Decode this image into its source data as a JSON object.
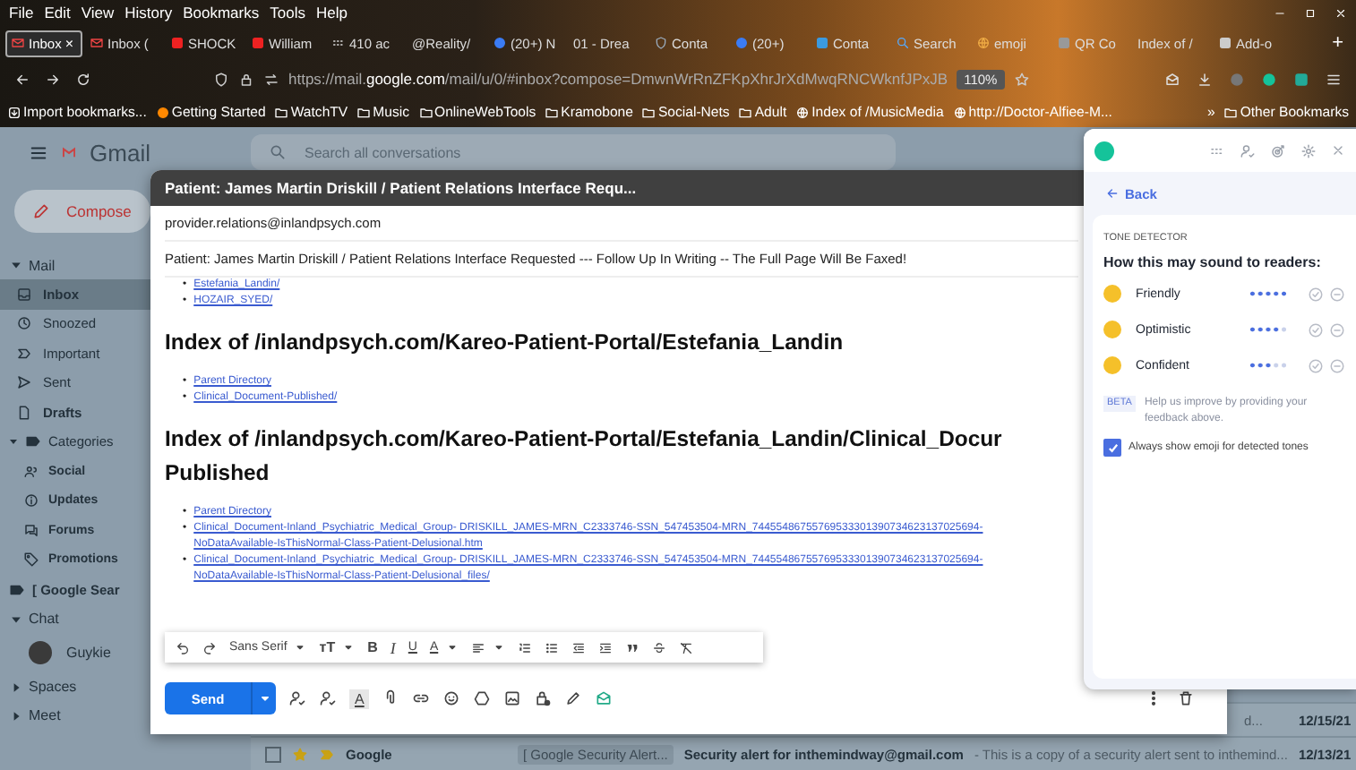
{
  "menu": [
    "File",
    "Edit",
    "View",
    "History",
    "Bookmarks",
    "Tools",
    "Help"
  ],
  "tabs": [
    {
      "label": "Inbox",
      "selected": true
    },
    {
      "label": "Inbox (",
      "selected": false
    },
    {
      "label": "SHOCK",
      "selected": false
    },
    {
      "label": "William",
      "selected": false
    },
    {
      "label": "410 ac",
      "selected": false
    },
    {
      "label": "@Reality/",
      "selected": false
    },
    {
      "label": "(20+) N",
      "selected": false
    },
    {
      "label": "01 - Drea",
      "selected": false
    },
    {
      "label": "Conta",
      "selected": false
    },
    {
      "label": "(20+)",
      "selected": false
    },
    {
      "label": "Conta",
      "selected": false
    },
    {
      "label": "Search",
      "selected": false
    },
    {
      "label": "emoji",
      "selected": false
    },
    {
      "label": "QR Co",
      "selected": false
    },
    {
      "label": "Index of /",
      "selected": false
    },
    {
      "label": "Add-o",
      "selected": false
    }
  ],
  "tab_close": "×",
  "new_tab": "+",
  "url": "https://mail.**google.com**/mail/u/0/#inbox?compose=DmwnWrRnZFKpXhrJrXdMwqRNCWknfJPxJB",
  "zoom": "110%",
  "bookmarks": [
    "Import bookmarks...",
    "Getting Started",
    "WatchTV",
    "Music",
    "OnlineWebTools",
    "Kramobone",
    "Social-Nets",
    "Adult",
    "Index of /MusicMedia",
    "http://Doctor-Alfiee-M..."
  ],
  "bookmarks_more": "»",
  "other_bookmarks": "Other Bookmarks",
  "gmail": {
    "logo": "Gmail",
    "search_placeholder": "Search all conversations",
    "compose": "Compose",
    "sections": [
      {
        "label": "Mail",
        "expanded": true,
        "items": [
          {
            "label": "Inbox",
            "unread": true,
            "selected": true
          },
          {
            "label": "Snoozed",
            "unread": false,
            "selected": false
          },
          {
            "label": "Important",
            "unread": false,
            "selected": false
          },
          {
            "label": "Sent",
            "unread": false,
            "selected": false
          },
          {
            "label": "Drafts",
            "unread": true,
            "selected": false
          },
          {
            "label": "Categories",
            "unread": false,
            "selected": false,
            "expanded": true,
            "children": [
              {
                "label": "Social",
                "unread": true,
                "selected": false
              },
              {
                "label": "Updates",
                "unread": true,
                "selected": false
              },
              {
                "label": "Forums",
                "unread": true,
                "selected": false
              },
              {
                "label": "Promotions",
                "unread": true,
                "selected": false
              }
            ]
          },
          {
            "label": "[ Google Sear",
            "unread": true,
            "selected": false
          }
        ]
      },
      {
        "label": "Chat",
        "expanded": true,
        "contacts": [
          {
            "name": "Guykie"
          }
        ]
      },
      {
        "label": "Spaces",
        "expanded": false
      },
      {
        "label": "Meet",
        "expanded": false
      }
    ],
    "rows": [
      {
        "snippet": "d...",
        "date": "12/15/21"
      },
      {
        "sender": "Google",
        "checked": false,
        "starred": true,
        "important": true,
        "label": "[ Google Security Alert...",
        "subject": "Security alert for inthemindway@gmail.com",
        "snippet": " - This is a copy of a security alert sent to inthemind...",
        "date": "12/13/21"
      }
    ]
  },
  "compose": {
    "title": "Patient: James Martin Driskill / Patient Relations Interface Requ...",
    "to": "provider.relations@inlandpsych.com",
    "subject": "Patient: James Martin Driskill /  Patient Relations Interface Requested --- Follow Up In Writing -- The Full Page Will Be Faxed!",
    "body": [
      {
        "kind": "list",
        "items": [
          {
            "lines": [
              "Estefania_Landin/"
            ]
          },
          {
            "lines": [
              "HOZAIR_SYED/"
            ]
          }
        ]
      },
      {
        "kind": "heading",
        "lines": [
          "Index of /inlandpsych.com/Kareo-Patient-Portal/Estefania_Landin"
        ]
      },
      {
        "kind": "list",
        "items": [
          {
            "lines": [
              "Parent Directory"
            ]
          },
          {
            "lines": [
              "Clinical_Document-Published/"
            ]
          }
        ]
      },
      {
        "kind": "heading",
        "lines": [
          "Index of /inlandpsych.com/Kareo-Patient-Portal/Estefania_Landin/Clinical_Docur",
          "Published"
        ]
      },
      {
        "kind": "list",
        "items": [
          {
            "lines": [
              "Parent Directory"
            ]
          },
          {
            "lines": [
              "Clinical_Document-Inland_Psychiatric_Medical_Group- DRISKILL_JAMES-MRN_C2333746-SSN_547453504-MRN_74455486755769533301390734623137025694-",
              "NoDataAvailable-IsThisNormal-Class-Patient-Delusional.htm"
            ]
          },
          {
            "lines": [
              "Clinical_Document-Inland_Psychiatric_Medical_Group- DRISKILL_JAMES-MRN_C2333746-SSN_547453504-MRN_74455486755769533301390734623137025694-",
              "NoDataAvailable-IsThisNormal-Class-Patient-Delusional_files/"
            ]
          }
        ]
      }
    ],
    "bullet": "•",
    "font": "Sans Serif",
    "font_size": "тT",
    "bold": "B",
    "italic": "I",
    "underline": "U",
    "text_color": "A",
    "formatting": "A",
    "send": "Send"
  },
  "grammarly": {
    "back": "Back",
    "heading": "TONE DETECTOR",
    "question": "How this may sound to readers:",
    "tones": [
      {
        "name": "Friendly",
        "level": 1
      },
      {
        "name": "Optimistic",
        "level": 0.8
      },
      {
        "name": "Confident",
        "level": 0.6
      }
    ],
    "beta": "BETA",
    "help": "Help us improve by providing your feedback above.",
    "emoji_option": {
      "label": "Always show emoji for detected tones",
      "checked": true
    }
  }
}
